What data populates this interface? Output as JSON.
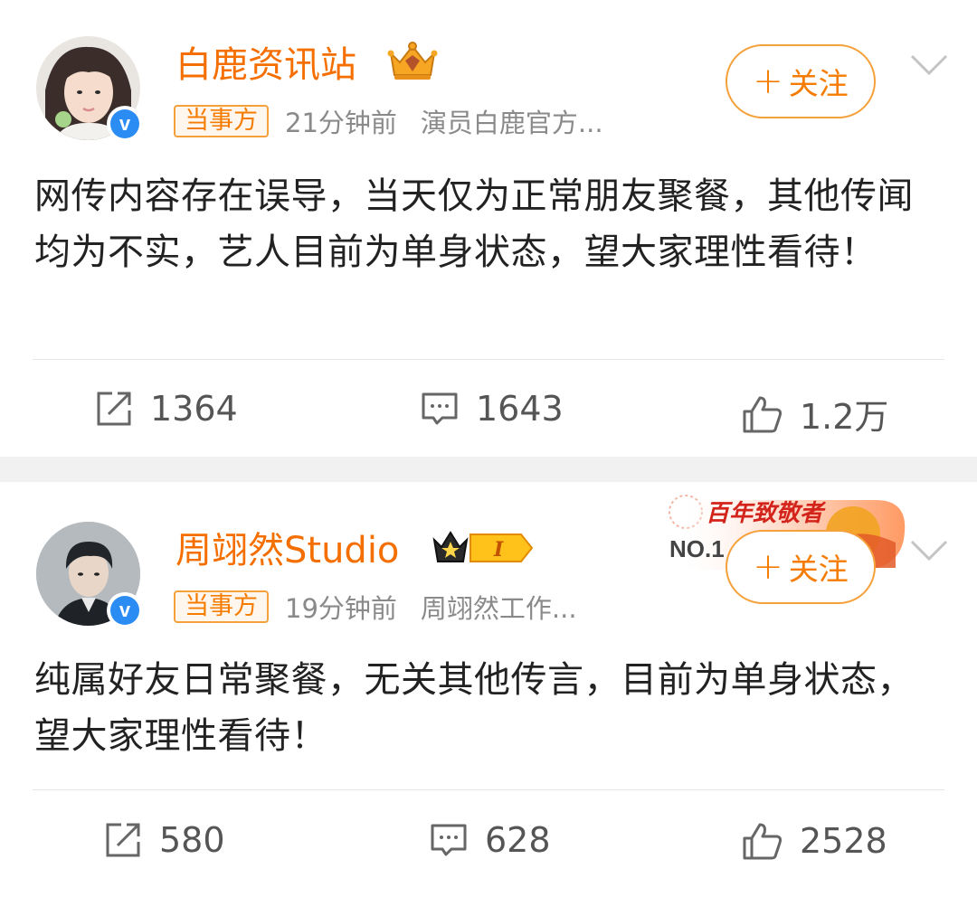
{
  "posts": [
    {
      "author": "白鹿资讯站",
      "tag": "当事方",
      "time": "21分钟前",
      "source": "演员白鹿官方...",
      "follow_label": "关注",
      "content": "网传内容存在误导，当天仅为正常朋友聚餐，其他传闻均为不实，艺人目前为单身状态，望大家理性看待！",
      "reposts": "1364",
      "comments": "1643",
      "likes": "1.2万"
    },
    {
      "author": "周翊然Studio",
      "tag": "当事方",
      "time": "19分钟前",
      "source": "周翊然工作...",
      "follow_label": "关注",
      "badge_title": "百年致敬者",
      "badge_rank": "NO.1",
      "level_badge": "I",
      "content": "纯属好友日常聚餐，无关其他传言，目前为单身状态，望大家理性看待！",
      "reposts": "580",
      "comments": "628",
      "likes": "2528"
    }
  ],
  "colors": {
    "accent": "#f56f00",
    "verified": "#2b8cf3",
    "separator": "#f1f1f1"
  }
}
